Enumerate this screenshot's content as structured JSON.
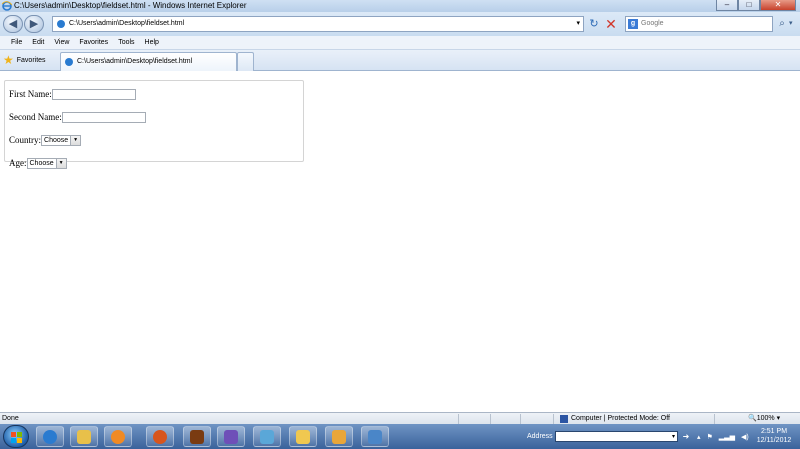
{
  "window": {
    "title": "C:\\Users\\admin\\Desktop\\fieldset.html - Windows Internet Explorer",
    "minimize_label": "–",
    "maximize_label": "□",
    "close_label": "✕"
  },
  "navigation": {
    "back_glyph": "◀",
    "forward_glyph": "▶",
    "url": "C:\\Users\\admin\\Desktop\\fieldset.html",
    "dropdown_glyph": "▾",
    "refresh_glyph": "↻",
    "stop_glyph": "✕",
    "search_provider_glyph": "g",
    "search_placeholder": "Google",
    "search_glyph": "⌕",
    "search_dropdown_glyph": "▾"
  },
  "menu": [
    "File",
    "Edit",
    "View",
    "Favorites",
    "Tools",
    "Help"
  ],
  "favorites_bar": {
    "star_glyph": "★",
    "favorites_label": "Favorites",
    "active_tab_label": "C:\\Users\\admin\\Desktop\\fieldset.html"
  },
  "form": {
    "first_name_label": "First Name:",
    "first_name_value": "",
    "second_name_label": "Second Name:",
    "second_name_value": "",
    "country_label": "Country:",
    "country_value": "Choose",
    "age_label": "Age:",
    "age_value": "Choose",
    "select_arrow_glyph": "▼"
  },
  "status_bar": {
    "status_text": "Done",
    "zone_text": "Computer | Protected Mode: Off",
    "zoom_text": "🔍100%  ▾"
  },
  "taskbar": {
    "address_label": "Address",
    "address_value": "",
    "address_dropdown_glyph": "▾",
    "go_glyph": "➜",
    "tray_up_glyph": "▴",
    "tray_flag_glyph": "⚑",
    "tray_signal_glyph": "▂▃▅",
    "tray_volume_glyph": "◀)",
    "clock_time": "2:51 PM",
    "clock_date": "12/11/2012"
  },
  "colors": {
    "icon_ie": "#2a7bd0",
    "icon_explorer": "#e8c04a",
    "icon_media": "#f08a24",
    "icon_firefox": "#d8551d",
    "icon_app5": "#7a3b12",
    "icon_app6": "#6e4fb8",
    "icon_app7": "#5aa7d8",
    "icon_app8": "#f0c850",
    "icon_app9": "#e9a63a",
    "icon_app10": "#4a86c8"
  }
}
